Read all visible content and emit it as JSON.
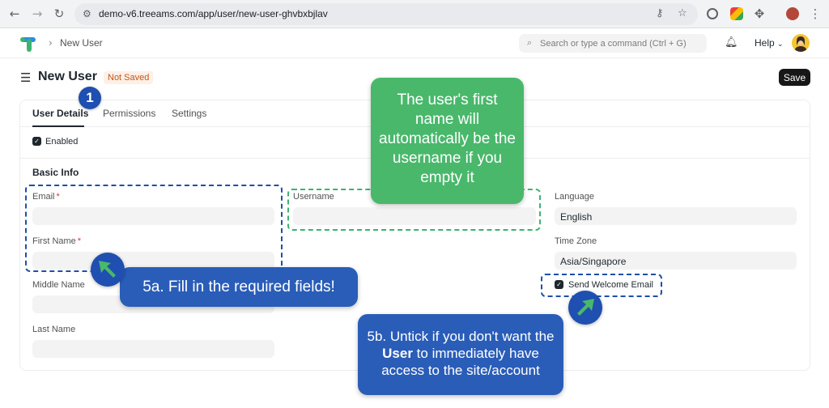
{
  "browser": {
    "url": "demo-v6.treeams.com/app/user/new-user-ghvbxbjlav"
  },
  "header": {
    "breadcrumb": "New User",
    "search_placeholder": "Search or type a command (Ctrl + G)",
    "help_label": "Help"
  },
  "page": {
    "title": "New User",
    "status_badge": "Not Saved",
    "save_label": "Save"
  },
  "tabs": [
    {
      "label": "User Details",
      "active": true
    },
    {
      "label": "Permissions",
      "active": false
    },
    {
      "label": "Settings",
      "active": false
    }
  ],
  "enabled": {
    "label": "Enabled",
    "checked": true
  },
  "basic_info": {
    "title": "Basic Info",
    "email": {
      "label": "Email",
      "required": true,
      "value": ""
    },
    "first_name": {
      "label": "First Name",
      "required": true,
      "value": ""
    },
    "middle_name": {
      "label": "Middle Name",
      "value": ""
    },
    "last_name": {
      "label": "Last Name",
      "value": ""
    },
    "username": {
      "label": "Username",
      "value": ""
    },
    "language": {
      "label": "Language",
      "value": "English"
    },
    "time_zone": {
      "label": "Time Zone",
      "value": "Asia/Singapore"
    },
    "send_welcome_email": {
      "label": "Send Welcome Email",
      "checked": true
    }
  },
  "annotations": {
    "step_number": "1",
    "username_tip": "The user's first name will automatically be the username if you empty it",
    "required_tip": "5a. Fill in the required fields!",
    "untick_tip_before": "5b. Untick if you don't want the ",
    "untick_tip_strong": "User",
    "untick_tip_after": " to immediately have access to the site/account"
  },
  "colors": {
    "callout_green": "#49b86b",
    "callout_blue": "#2a5db8",
    "dash_blue": "#1e4fa8",
    "dash_green": "#3cb371",
    "status_orange": "#c0541d"
  }
}
